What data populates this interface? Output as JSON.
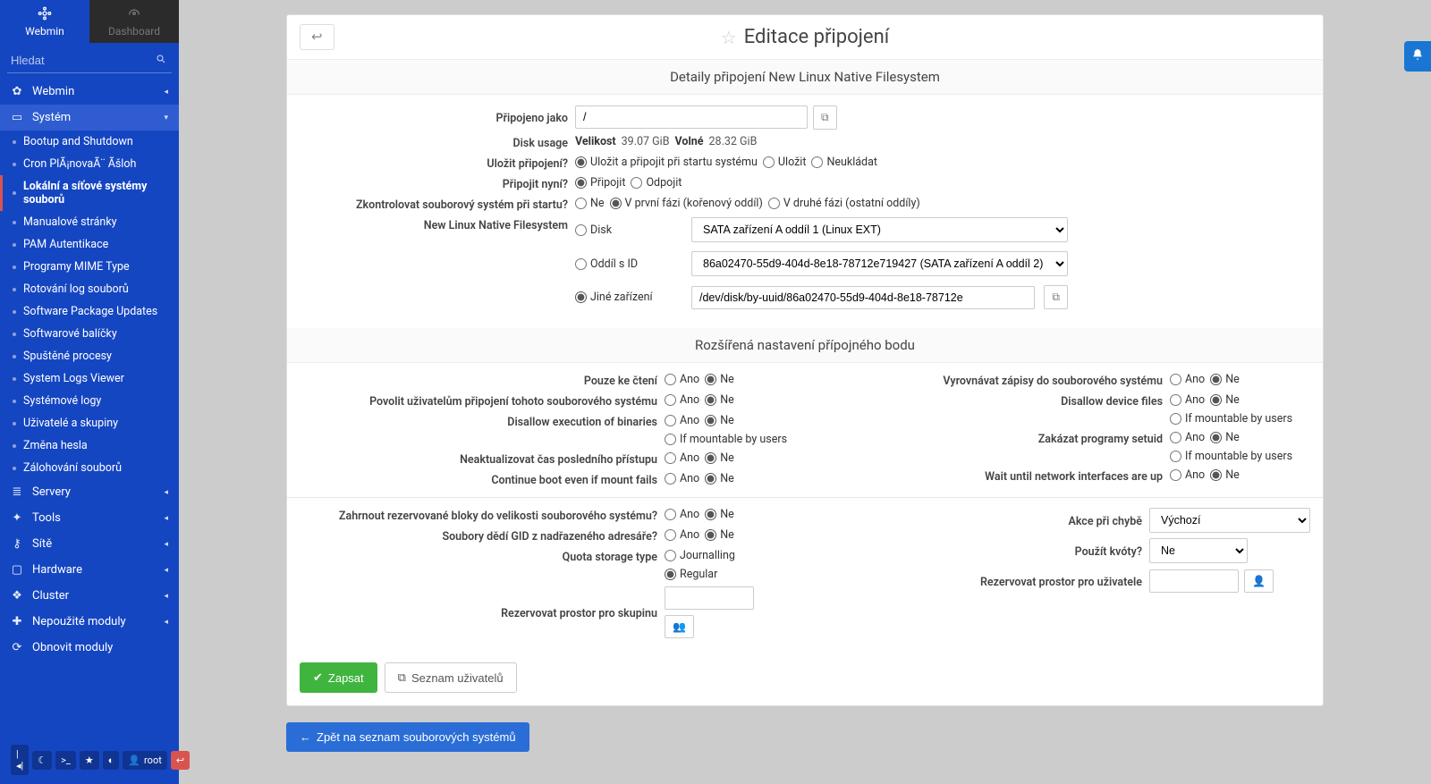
{
  "tabs": {
    "webmin": "Webmin",
    "dashboard": "Dashboard"
  },
  "search": {
    "placeholder": "Hledat"
  },
  "nav": {
    "webmin": "Webmin",
    "system": "Systém",
    "system_items": [
      "Bootup and Shutdown",
      "Cron PlÃ¡novaÃ¨ Ãšloh",
      "Lokální a síťové systémy souborů",
      "Manualové stránky",
      "PAM Autentikace",
      "Programy MIME Type",
      "Rotování log souborů",
      "Software Package Updates",
      "Softwarové balíčky",
      "Spuštěné procesy",
      "System Logs Viewer",
      "Systémové logy",
      "Uživatelé a skupiny",
      "Změna hesla",
      "Zálohování souborů"
    ],
    "servers": "Servery",
    "tools": "Tools",
    "site": "Sítě",
    "hardware": "Hardware",
    "cluster": "Cluster",
    "unused": "Nepoužité moduly",
    "refresh": "Obnovit moduly"
  },
  "userbar": {
    "user": "root"
  },
  "page": {
    "title": "Editace připojení",
    "details_header": "Detaily připojení New Linux Native Filesystem",
    "mounted_as": {
      "label": "Připojeno jako",
      "value": "/"
    },
    "disk_usage": {
      "label": "Disk usage",
      "size_lbl": "Velikost",
      "size_val": "39.07 GiB",
      "free_lbl": "Volné",
      "free_val": "28.32 GiB"
    },
    "save_mount": {
      "label": "Uložit připojení?",
      "opt1": "Uložit a připojit při startu systému",
      "opt2": "Uložit",
      "opt3": "Neukládat"
    },
    "mount_now": {
      "label": "Připojit nyní?",
      "opt1": "Připojit",
      "opt2": "Odpojit"
    },
    "fsck": {
      "label": "Zkontrolovat souborový systém při startu?",
      "opt1": "Ne",
      "opt2": "V první fázi (kořenový oddíl)",
      "opt3": "V druhé fázi (ostatní oddíly)"
    },
    "nlnf": {
      "label": "New Linux Native Filesystem",
      "disk_lbl": "Disk",
      "disk_sel": "SATA zařízení A oddíl 1 (Linux EXT)",
      "partid_lbl": "Oddíl s ID",
      "partid_sel": "86a02470-55d9-404d-8e18-78712e719427 (SATA zařízení A oddíl 2)",
      "other_lbl": "Jiné zařízení",
      "other_val": "/dev/disk/by-uuid/86a02470-55d9-404d-8e18-78712e"
    },
    "adv_header": "Rozšířená nastavení přípojného bodu",
    "opts_left": [
      {
        "label": "Pouze ke čtení",
        "sel": "ne"
      },
      {
        "label": "Povolit uživatelům připojení tohoto souborového systému",
        "sel": "ne"
      },
      {
        "label": "Disallow execution of binaries",
        "sel": "ne",
        "extra": "If mountable by users"
      },
      {
        "label": "Neaktualizovat čas posledního přístupu",
        "sel": "ne"
      },
      {
        "label": "Continue boot even if mount fails",
        "sel": "ne"
      }
    ],
    "opts_right": [
      {
        "label": "Vyrovnávat zápisy do souborového systému",
        "sel": "ne"
      },
      {
        "label": "Disallow device files",
        "sel": "ne",
        "extra": "If mountable by users"
      },
      {
        "label": "Zakázat programy setuid",
        "sel": "ne",
        "extra": "If mountable by users"
      },
      {
        "label": "Wait until network interfaces are up",
        "sel": "ne"
      }
    ],
    "radio": {
      "yes": "Ano",
      "no": "Ne"
    },
    "reserved": {
      "label": "Zahrnout rezervované bloky do velikosti souborového systému?"
    },
    "gid": {
      "label": "Soubory dědí GID z nadřazeného adresáře?"
    },
    "quota_type": {
      "label": "Quota storage type",
      "journalling": "Journalling",
      "regular": "Regular"
    },
    "reserve_group": {
      "label": "Rezervovat prostor pro skupinu"
    },
    "err_action": {
      "label": "Akce při chybě",
      "val": "Výchozí"
    },
    "use_quotas": {
      "label": "Použít kvóty?",
      "val": "Ne"
    },
    "reserve_user": {
      "label": "Rezervovat prostor pro uživatele"
    },
    "btn_save": "Zapsat",
    "btn_users": "Seznam uživatelů",
    "btn_back": "Zpět na seznam souborových systémů"
  }
}
